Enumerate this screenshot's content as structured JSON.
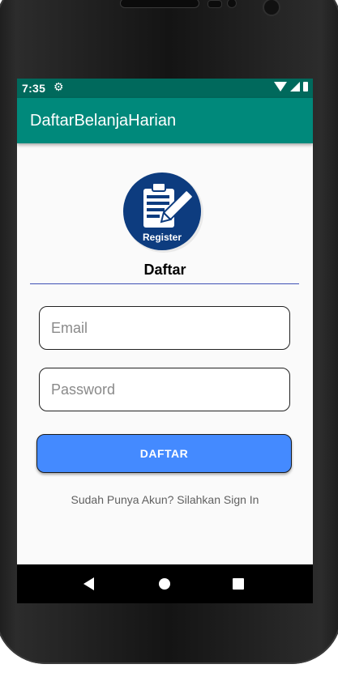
{
  "status_bar": {
    "time": "7:35",
    "icons": [
      "gear-icon",
      "wifi-icon",
      "signal-icon",
      "battery-icon"
    ]
  },
  "app_bar": {
    "title": "DaftarBelanjaHarian",
    "color": "#00897b"
  },
  "logo": {
    "label": "Register",
    "icon": "clipboard-pen-icon",
    "color": "#0d3c7f"
  },
  "form": {
    "heading": "Daftar",
    "email": {
      "placeholder": "Email",
      "value": ""
    },
    "password": {
      "placeholder": "Password",
      "value": ""
    },
    "submit_label": "DAFTAR",
    "signin_text": "Sudah Punya Akun? Silahkan Sign In"
  },
  "colors": {
    "accent": "#448aff",
    "status_bar": "#00695c",
    "divider": "#3f51b5"
  },
  "nav_bar": {
    "icons": [
      "back-icon",
      "home-icon",
      "recents-icon"
    ]
  }
}
